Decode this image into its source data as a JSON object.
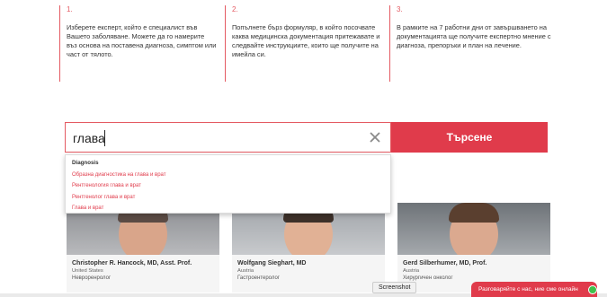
{
  "steps": [
    {
      "number": "1.",
      "text": "Изберете експерт, който е специалист във Вашето заболяване. Можете да го намерите въз основа на поставена диагноза, симптом или част от тялото."
    },
    {
      "number": "2.",
      "text": "Попълнете бърз формуляр, в който посочвате каква медицинска документация притежавате и следвайте инструкциите, които ще получите на имейла си."
    },
    {
      "number": "3.",
      "text": "В рамките на 7 работни дни от завършването на документацията ще получите експертно мнение с диагноза, препоръки и план на лечение."
    }
  ],
  "search": {
    "value": "глава",
    "button_label": "Търсене",
    "clear_icon": "close-icon"
  },
  "suggestions": {
    "heading": "Diagnosis",
    "items": [
      "Образна диагностика на глава и врат",
      "Рентгенология глава и врат",
      "Рентгенолог глава и врат",
      "Глава и врат"
    ]
  },
  "doctors": [
    {
      "name": "Christopher R. Hancock, MD, Asst. Prof.",
      "country": "United States",
      "specialty": "Невроренролог"
    },
    {
      "name": "Wolfgang Sieghart, MD",
      "country": "Austria",
      "specialty": "Гастроентеролог"
    },
    {
      "name": "Gerd Silberhumer, MD, Prof.",
      "country": "Austria",
      "specialty": "Хирургичен онколог"
    }
  ],
  "overlay": {
    "screenshot_label": "Screenshot",
    "chat_label": "Разговаряйте с нас, ние сме онлайн"
  },
  "colors": {
    "accent": "#e03b4b",
    "step_border": "#e45a62",
    "online": "#3fbf4b"
  }
}
